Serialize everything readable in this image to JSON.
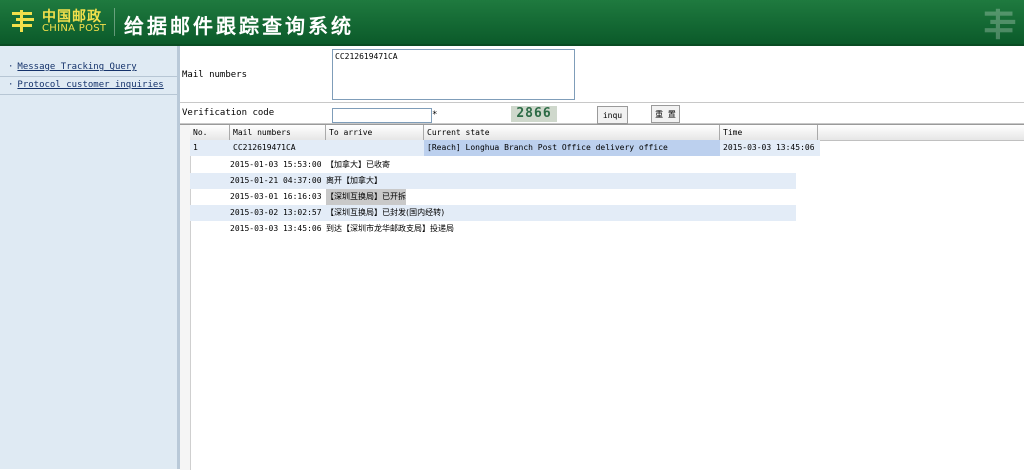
{
  "header": {
    "logo_cn": "中国邮政",
    "logo_en": "CHINA POST",
    "title": "给据邮件跟踪查询系统"
  },
  "sidebar": {
    "items": [
      {
        "bullet": "·",
        "label": "Message Tracking Query"
      },
      {
        "bullet": "·",
        "label": "Protocol customer inquiries"
      }
    ]
  },
  "form": {
    "mail_label": "Mail numbers",
    "mail_value": "CC212619471CA",
    "code_label": "Verification code",
    "code_value": "",
    "required_mark": "*",
    "captcha_text": "2866",
    "query_button": "inqu",
    "reset_button": "重 置"
  },
  "table": {
    "columns": [
      "No.",
      "Mail numbers",
      "To arrive",
      "Current state",
      "Time"
    ],
    "row": {
      "no": "1",
      "mail": "CC212619471CA",
      "arrive": "",
      "state": "[Reach] Longhua Branch Post Office delivery office",
      "time": "2015-03-03 13:45:06"
    },
    "details": [
      {
        "time": "2015-01-03 15:53:00",
        "desc": "【加拿大】已收寄"
      },
      {
        "time": "2015-01-21 04:37:00",
        "desc": "离开【加拿大】"
      },
      {
        "time": "2015-03-01 16:16:03",
        "desc": "【深圳互换局】已开拆"
      },
      {
        "time": "2015-03-02 13:02:57",
        "desc": "【深圳互换局】已封发(国内经转)"
      },
      {
        "time": "2015-03-03 13:45:06",
        "desc": "到达【深圳市龙华邮政支局】投递局"
      }
    ]
  },
  "colors": {
    "header_green": "#0b5a2a",
    "logo_yellow": "#f2e04b",
    "row_blue": "#e3ecf7",
    "state_blue": "#bcd0ee"
  }
}
